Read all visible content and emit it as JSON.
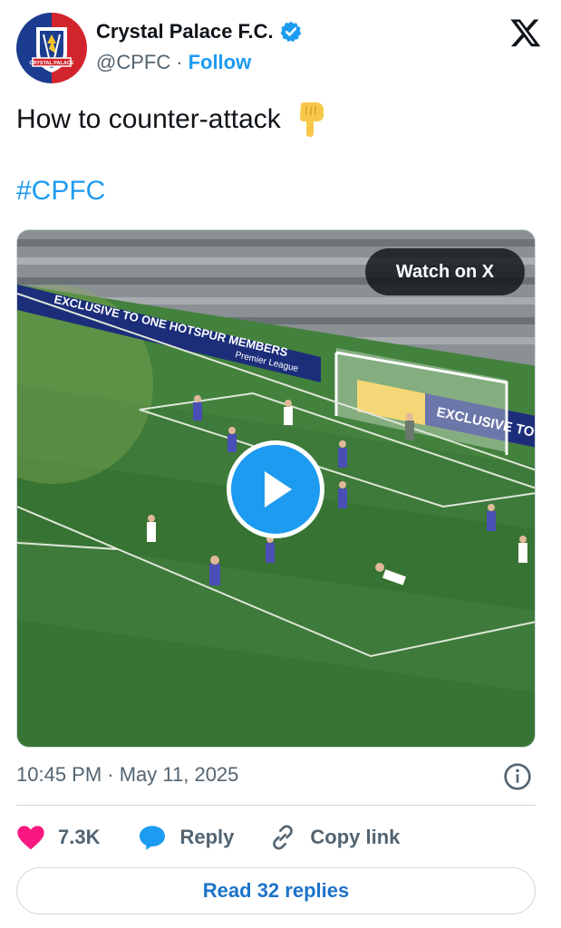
{
  "author": {
    "display_name": "Crystal Palace F.C.",
    "handle": "@CPFC",
    "separator": "·",
    "follow_label": "Follow",
    "avatar_text": "CRYSTAL PALACE"
  },
  "tweet": {
    "text": "How to counter-attack",
    "hashtag": "#CPFC",
    "timestamp": "10:45 PM · May 11, 2025"
  },
  "media": {
    "watch_label": "Watch on X",
    "ad_boards": [
      "EXCLUSIVE TO ONE HOTSPUR MEMBERS",
      "Premier League",
      "EXCLUSIVE TO"
    ]
  },
  "actions": {
    "likes": "7.3K",
    "reply_label": "Reply",
    "copy_label": "Copy link",
    "read_replies": "Read 32 replies"
  },
  "colors": {
    "accent": "#1d9bf0",
    "like": "#f91880",
    "text": "#0f1419",
    "muted": "#536471"
  }
}
